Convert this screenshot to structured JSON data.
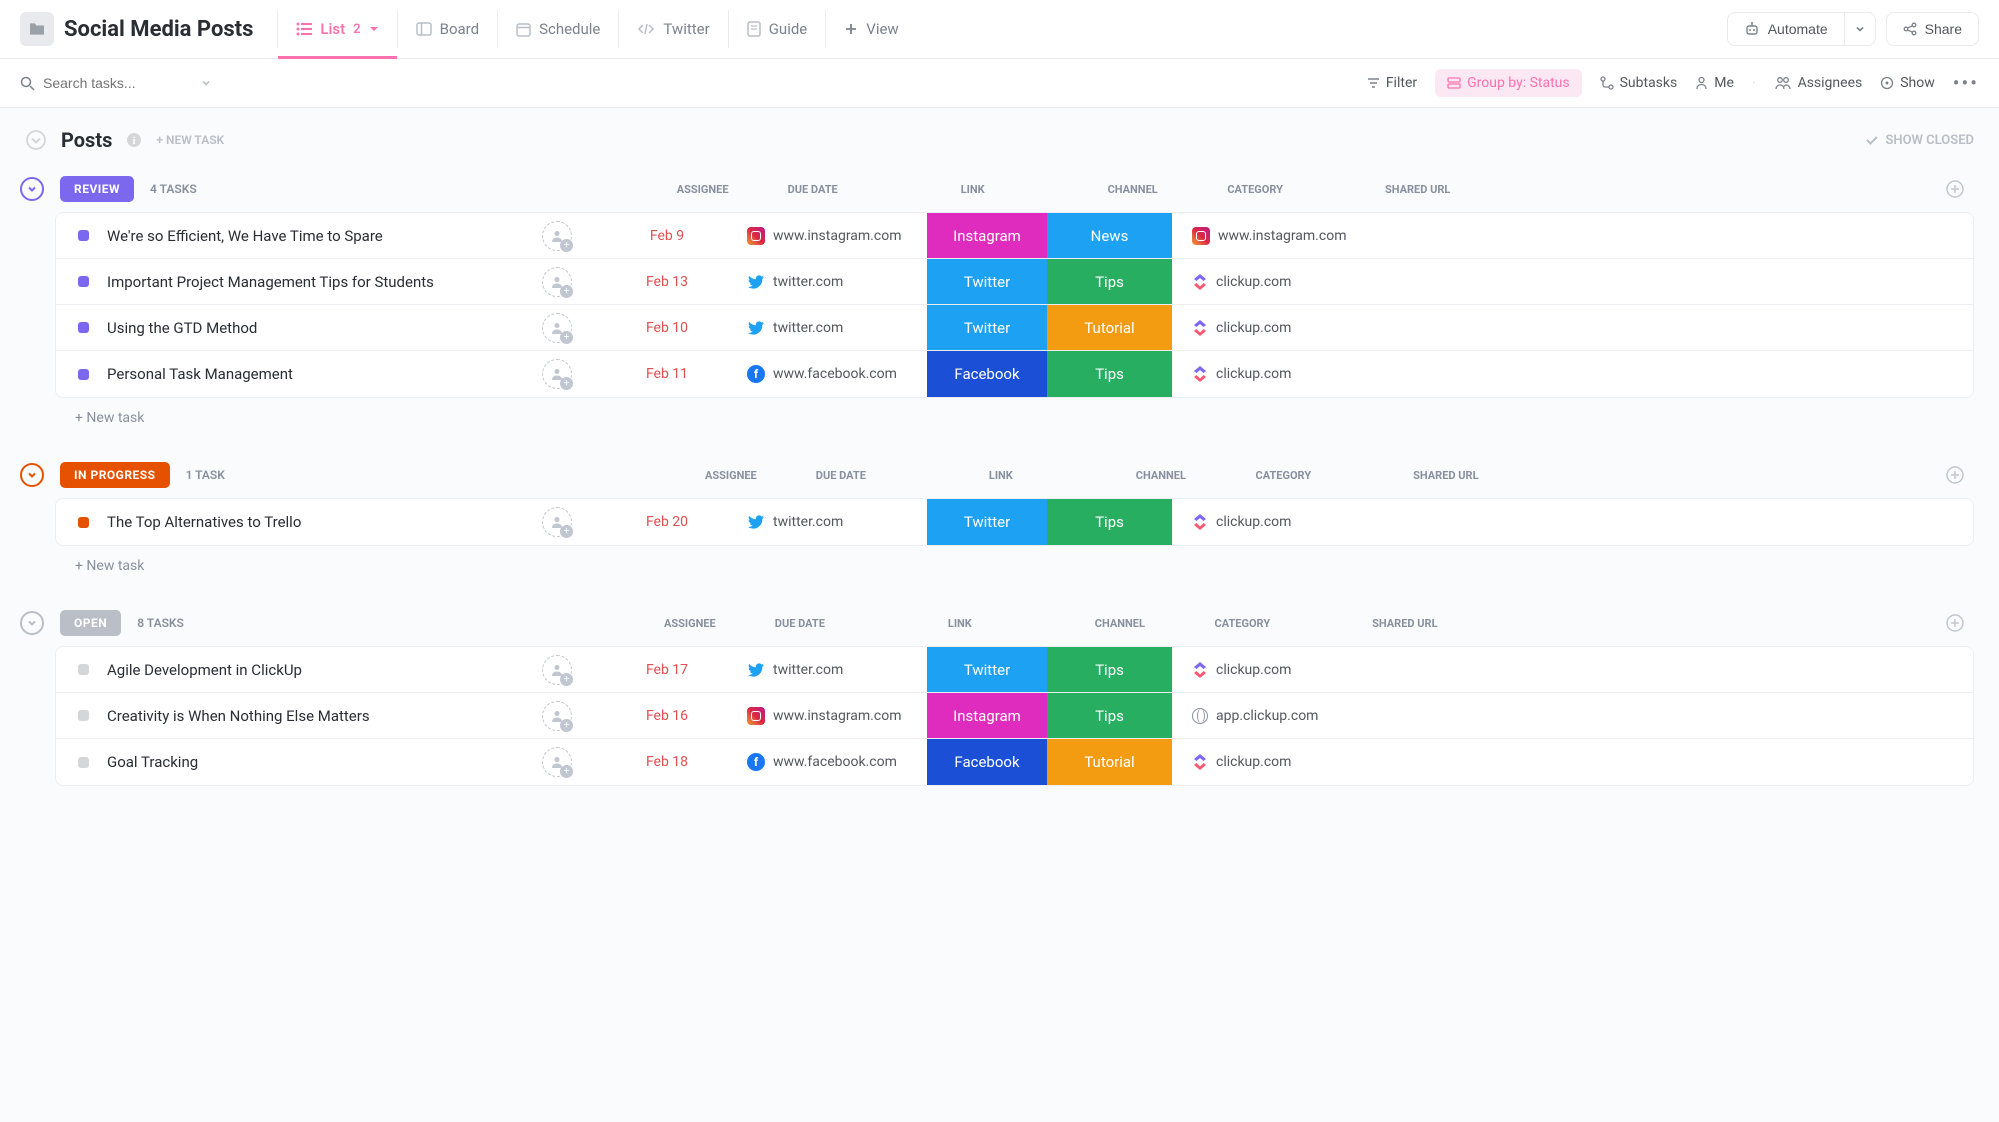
{
  "header": {
    "title": "Social Media Posts",
    "tabs": [
      {
        "label": "List",
        "badge": "2",
        "active": true
      },
      {
        "label": "Board"
      },
      {
        "label": "Schedule"
      },
      {
        "label": "Twitter"
      },
      {
        "label": "Guide"
      },
      {
        "label": "View",
        "add": true
      }
    ],
    "automate": "Automate",
    "share": "Share"
  },
  "toolbar": {
    "search_placeholder": "Search tasks...",
    "filter": "Filter",
    "group_by": "Group by: Status",
    "subtasks": "Subtasks",
    "me": "Me",
    "assignees": "Assignees",
    "show": "Show"
  },
  "list_header": {
    "title": "Posts",
    "new_task": "+ NEW TASK",
    "show_closed": "SHOW CLOSED"
  },
  "columns": {
    "assignee": "ASSIGNEE",
    "due": "DUE DATE",
    "link": "LINK",
    "channel": "CHANNEL",
    "category": "CATEGORY",
    "shared": "SHARED URL"
  },
  "groups": [
    {
      "id": "review",
      "label": "REVIEW",
      "count": "4 TASKS",
      "tasks": [
        {
          "name": "We're so Efficient, We Have Time to Spare",
          "due": "Feb 9",
          "link": "www.instagram.com",
          "link_icon": "instagram",
          "channel": "Instagram",
          "channel_class": "ch-instagram",
          "category": "News",
          "category_class": "cat-news",
          "shared": "www.instagram.com",
          "shared_icon": "instagram"
        },
        {
          "name": "Important Project Management Tips for Students",
          "due": "Feb 13",
          "link": "twitter.com",
          "link_icon": "twitter",
          "channel": "Twitter",
          "channel_class": "ch-twitter",
          "category": "Tips",
          "category_class": "cat-tips",
          "shared": "clickup.com",
          "shared_icon": "clickup"
        },
        {
          "name": "Using the GTD Method",
          "due": "Feb 10",
          "link": "twitter.com",
          "link_icon": "twitter",
          "channel": "Twitter",
          "channel_class": "ch-twitter",
          "category": "Tutorial",
          "category_class": "cat-tutorial",
          "shared": "clickup.com",
          "shared_icon": "clickup"
        },
        {
          "name": "Personal Task Management",
          "due": "Feb 11",
          "link": "www.facebook.com",
          "link_icon": "facebook",
          "channel": "Facebook",
          "channel_class": "ch-facebook",
          "category": "Tips",
          "category_class": "cat-tips",
          "shared": "clickup.com",
          "shared_icon": "clickup"
        }
      ],
      "new_task": "+ New task"
    },
    {
      "id": "progress",
      "label": "IN PROGRESS",
      "count": "1 TASK",
      "tasks": [
        {
          "name": "The Top Alternatives to Trello",
          "due": "Feb 20",
          "link": "twitter.com",
          "link_icon": "twitter",
          "channel": "Twitter",
          "channel_class": "ch-twitter",
          "category": "Tips",
          "category_class": "cat-tips",
          "shared": "clickup.com",
          "shared_icon": "clickup"
        }
      ],
      "new_task": "+ New task"
    },
    {
      "id": "open",
      "label": "OPEN",
      "count": "8 TASKS",
      "tasks": [
        {
          "name": "Agile Development in ClickUp",
          "due": "Feb 17",
          "link": "twitter.com",
          "link_icon": "twitter",
          "channel": "Twitter",
          "channel_class": "ch-twitter",
          "category": "Tips",
          "category_class": "cat-tips",
          "shared": "clickup.com",
          "shared_icon": "clickup"
        },
        {
          "name": "Creativity is When Nothing Else Matters",
          "due": "Feb 16",
          "link": "www.instagram.com",
          "link_icon": "instagram",
          "channel": "Instagram",
          "channel_class": "ch-instagram",
          "category": "Tips",
          "category_class": "cat-tips",
          "shared": "app.clickup.com",
          "shared_icon": "globe"
        },
        {
          "name": "Goal Tracking",
          "due": "Feb 18",
          "link": "www.facebook.com",
          "link_icon": "facebook",
          "channel": "Facebook",
          "channel_class": "ch-facebook",
          "category": "Tutorial",
          "category_class": "cat-tutorial",
          "shared": "clickup.com",
          "shared_icon": "clickup"
        }
      ]
    }
  ]
}
